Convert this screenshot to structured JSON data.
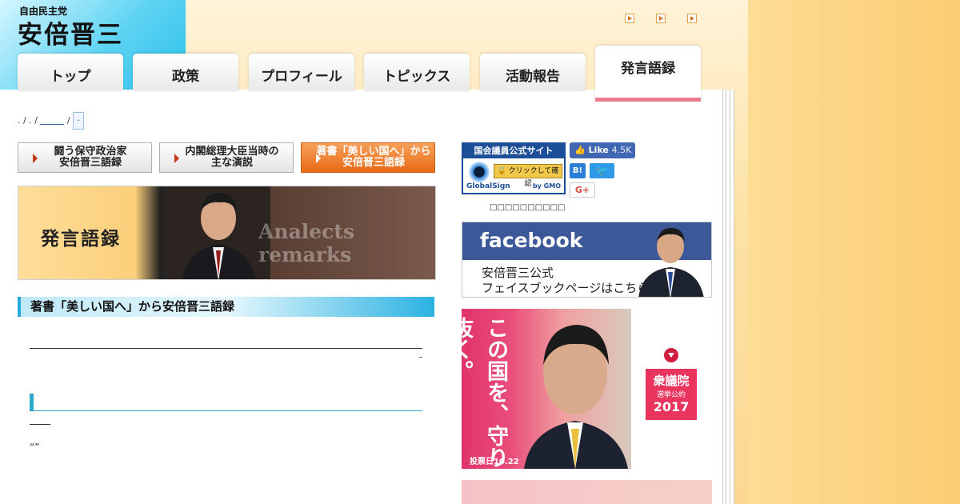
{
  "header": {
    "party": "自由民主党",
    "name": "安倍晋三"
  },
  "nav": {
    "tabs": [
      {
        "label": "トップ"
      },
      {
        "label": "政策"
      },
      {
        "label": "プロフィール"
      },
      {
        "label": "トピックス"
      },
      {
        "label": "活動報告"
      },
      {
        "label": "発言語録",
        "active": true
      }
    ]
  },
  "breadcrumb": {
    "sep1": ". / . /",
    "sep2": "/",
    "current": "."
  },
  "subnav": [
    {
      "line1": "闘う保守政治家",
      "line2": "安倍晋三語録"
    },
    {
      "line1": "内閣総理大臣当時の",
      "line2": "主な演説"
    },
    {
      "line1": "著書「美しい国へ」から",
      "line2": "安倍晋三語録",
      "active": true
    }
  ],
  "hero": {
    "title": "発言語録",
    "subtitle": "Analects remarks"
  },
  "section": {
    "heading": "著書「美しい国へ」から安倍晋三語録",
    "quote_marks": "“”"
  },
  "sidebar": {
    "globalsign": {
      "top_label": "国会議員公式サイト",
      "click_label": "クリックして確認",
      "brand": "GlobalSign",
      "by": "by GMO"
    },
    "like": {
      "label": "Like",
      "count": "4.5K"
    },
    "hatena": "B!",
    "twitter": "🐦",
    "gplus": "G+",
    "caption": "□□□□□□□□□□",
    "facebook_banner": {
      "brand": "facebook",
      "line1": "安倍晋三公式",
      "line2": "フェイスブックページはこちら"
    },
    "election": {
      "slogan": "この国を、守り抜く。",
      "date": "投票日10.22",
      "pledge_l1": "衆議院",
      "pledge_l2": "選挙公約",
      "pledge_l3": "2017"
    }
  },
  "colors": {
    "accent_orange": "#e96a17",
    "facebook_blue": "#3b5998",
    "section_cyan": "#2ab2e2",
    "pledge_red": "#e9355d"
  }
}
